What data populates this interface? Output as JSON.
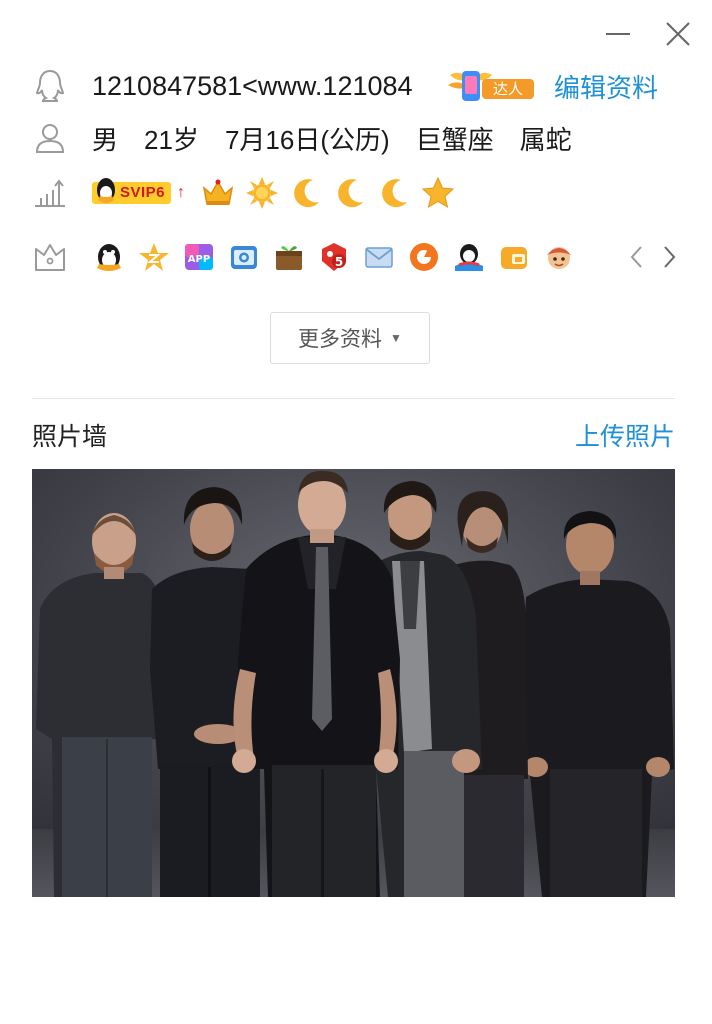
{
  "window": {
    "minimize_icon": "minimize-icon",
    "close_icon": "close-icon"
  },
  "profile": {
    "qq_number": "1210847581<www.121084",
    "talent_badge_text": "达人",
    "edit_label": "编辑资料",
    "gender": "男",
    "age": "21岁",
    "birthday": "7月16日(公历)",
    "zodiac": "巨蟹座",
    "chinese_zodiac": "属蛇"
  },
  "level": {
    "svip_label": "SVIP6",
    "icons": [
      "crown",
      "sun",
      "moon",
      "moon",
      "moon",
      "star"
    ]
  },
  "services": {
    "icons": [
      "qq-penguin",
      "qzone-star",
      "app",
      "camera",
      "game-box",
      "pet",
      "mail",
      "music",
      "qq-show",
      "wallet",
      "character"
    ]
  },
  "more_button": {
    "label": "更多资料"
  },
  "photo_wall": {
    "title": "照片墙",
    "upload_label": "上传照片"
  },
  "colors": {
    "link": "#1e90d6",
    "svip_bg": "#ffcc2b",
    "svip_text": "#d0181b"
  }
}
